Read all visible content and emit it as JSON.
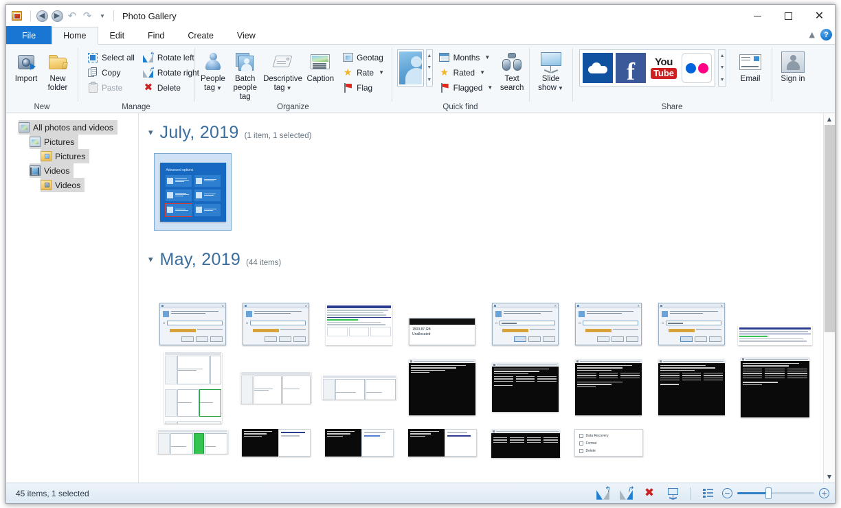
{
  "window": {
    "title": "Photo Gallery",
    "app_icon": "photo-gallery-icon",
    "quick_access": [
      {
        "name": "back-button",
        "icon": "back-arrow-icon"
      },
      {
        "name": "forward-button",
        "icon": "forward-arrow-icon"
      },
      {
        "name": "undo-button",
        "icon": "undo-icon"
      },
      {
        "name": "redo-button",
        "icon": "redo-icon"
      },
      {
        "name": "customize-qat-button",
        "icon": "chevron-down-icon"
      }
    ],
    "controls": {
      "minimize": "minimize-icon",
      "maximize": "maximize-icon",
      "close": "close-icon"
    }
  },
  "tabs": [
    {
      "label": "File",
      "state": "file"
    },
    {
      "label": "Home",
      "state": "active"
    },
    {
      "label": "Edit",
      "state": "normal"
    },
    {
      "label": "Find",
      "state": "normal"
    },
    {
      "label": "Create",
      "state": "normal"
    },
    {
      "label": "View",
      "state": "normal"
    }
  ],
  "tabstrip_right": {
    "collapse_ribbon": "chevron-up-icon",
    "help": "?"
  },
  "ribbon": {
    "groups": [
      {
        "name": "New",
        "label": "New",
        "big_buttons": [
          {
            "label": "Import",
            "icon": "camera-import-icon"
          },
          {
            "label": "New folder",
            "icon": "new-folder-icon"
          }
        ]
      },
      {
        "name": "Manage",
        "label": "Manage",
        "small_columns": [
          [
            {
              "label": "Select all",
              "icon": "select-all-icon",
              "disabled": false
            },
            {
              "label": "Copy",
              "icon": "copy-icon",
              "disabled": false
            },
            {
              "label": "Paste",
              "icon": "paste-icon",
              "disabled": true
            }
          ],
          [
            {
              "label": "Rotate left",
              "icon": "rotate-left-icon",
              "disabled": false
            },
            {
              "label": "Rotate right",
              "icon": "rotate-right-icon",
              "disabled": false
            },
            {
              "label": "Delete",
              "icon": "delete-icon",
              "disabled": false
            }
          ]
        ]
      },
      {
        "name": "Organize",
        "label": "Organize",
        "big_buttons": [
          {
            "label": "People tag",
            "icon": "person-icon",
            "dropdown": true
          },
          {
            "label": "Batch people tag",
            "icon": "batch-people-icon",
            "dropdown": false
          },
          {
            "label": "Descriptive tag",
            "icon": "tag-icon",
            "dropdown": true
          },
          {
            "label": "Caption",
            "icon": "caption-icon",
            "dropdown": false
          }
        ],
        "small_columns": [
          [
            {
              "label": "Geotag",
              "icon": "geotag-icon",
              "dropdown": false
            },
            {
              "label": "Rate",
              "icon": "star-icon",
              "dropdown": true
            },
            {
              "label": "Flag",
              "icon": "flag-icon",
              "dropdown": false
            }
          ]
        ]
      },
      {
        "name": "Quick find",
        "label": "Quick find",
        "gallery": {
          "name": "people-preview",
          "icon": "person-portrait-icon"
        },
        "small_columns": [
          [
            {
              "label": "Months",
              "icon": "calendar-icon",
              "dropdown": true
            },
            {
              "label": "Rated",
              "icon": "star-icon",
              "dropdown": true
            },
            {
              "label": "Flagged",
              "icon": "flag-icon",
              "dropdown": true
            }
          ]
        ],
        "big_buttons": [
          {
            "label": "Text search",
            "icon": "binoculars-icon",
            "dropdown": false
          }
        ]
      },
      {
        "name": "Slideshow",
        "label": "",
        "big_buttons": [
          {
            "label": "Slide show",
            "icon": "projector-icon",
            "dropdown": true
          }
        ]
      },
      {
        "name": "Share",
        "label": "Share",
        "tiles": [
          {
            "name": "onedrive-tile",
            "label": "OneDrive"
          },
          {
            "name": "facebook-tile",
            "label": "f"
          },
          {
            "name": "youtube-tile",
            "label_top": "You",
            "label_bottom": "Tube"
          },
          {
            "name": "flickr-tile",
            "label": "Flickr"
          }
        ],
        "big_buttons": [
          {
            "label": "Email",
            "icon": "email-icon",
            "dropdown": false
          }
        ]
      },
      {
        "name": "SignIn",
        "label": "",
        "big_buttons": [
          {
            "label": "Sign in",
            "icon": "signin-person-icon",
            "dropdown": false
          }
        ]
      }
    ]
  },
  "sidebar": {
    "items": [
      {
        "label": "All photos and videos",
        "icon": "all-media-icon",
        "indent": 0,
        "selected": true
      },
      {
        "label": "Pictures",
        "icon": "pictures-library-icon",
        "indent": 1,
        "selected": true
      },
      {
        "label": "Pictures",
        "icon": "pictures-folder-icon",
        "indent": 2,
        "selected": true
      },
      {
        "label": "Videos",
        "icon": "videos-library-icon",
        "indent": 1,
        "selected": true
      },
      {
        "label": "Videos",
        "icon": "videos-folder-icon",
        "indent": 2,
        "selected": true
      }
    ]
  },
  "gallery": {
    "groups": [
      {
        "title": "July, 2019",
        "count": "(1 item, 1 selected)",
        "chevron": "chevron-down-icon",
        "thumbnails": [
          {
            "name": "thumbnail-advanced-options",
            "kind": "winblue",
            "caption": "Advanced options",
            "selected": true,
            "tiles": [
              "Startup Repair",
              "Command Prompt",
              "System Image Recovery",
              "Startup Settings",
              "Startup Repair",
              "UEFI Firmware Settings"
            ]
          }
        ]
      },
      {
        "title": "May, 2019",
        "count": "(44 items)",
        "chevron": "chevron-down-icon",
        "rows": [
          [
            {
              "name": "thumbnail-run-dialog-1",
              "kind": "dialog",
              "filled": false
            },
            {
              "name": "thumbnail-run-dialog-2",
              "kind": "dialog",
              "filled": false
            },
            {
              "name": "thumbnail-disk-table-1",
              "kind": "report"
            },
            {
              "name": "thumbnail-unallocated",
              "kind": "unalloc",
              "line1": "1503.87 GB",
              "line2": "Unallocated"
            },
            {
              "name": "thumbnail-run-dialog-3",
              "kind": "dialog",
              "filled": true
            },
            {
              "name": "thumbnail-run-dialog-4",
              "kind": "dialog",
              "filled": false
            },
            {
              "name": "thumbnail-run-dialog-5",
              "kind": "dialog",
              "filled": true
            },
            {
              "name": "thumbnail-disk-table-2",
              "kind": "report-wide"
            }
          ],
          [
            {
              "name": "thumbnail-disk-management-menu",
              "kind": "diskmenu"
            },
            {
              "name": "thumbnail-disk-management-1",
              "kind": "diskmgr"
            },
            {
              "name": "thumbnail-disk-management-2",
              "kind": "diskmgr-wide"
            },
            {
              "name": "thumbnail-cmd-1",
              "kind": "terminal"
            },
            {
              "name": "thumbnail-cmd-2",
              "kind": "terminal"
            },
            {
              "name": "thumbnail-cmd-3",
              "kind": "terminal"
            },
            {
              "name": "thumbnail-cmd-4",
              "kind": "terminal"
            },
            {
              "name": "thumbnail-cmd-5",
              "kind": "terminal"
            }
          ],
          [
            {
              "name": "thumbnail-disk-management-3",
              "kind": "diskmgr-wide"
            },
            {
              "name": "thumbnail-cmd-6",
              "kind": "terminal-split"
            },
            {
              "name": "thumbnail-cmd-7",
              "kind": "terminal-split"
            },
            {
              "name": "thumbnail-cmd-8",
              "kind": "terminal-split"
            },
            {
              "name": "thumbnail-cmd-9",
              "kind": "terminal-split"
            },
            {
              "name": "thumbnail-context-menu",
              "kind": "menu",
              "items": [
                "Data Recovery",
                "Format",
                "Delete"
              ]
            }
          ]
        ]
      }
    ]
  },
  "scrollbar": {
    "up_arrow": "chevron-up-icon",
    "down_arrow": "chevron-down-icon",
    "thumb_top_pct": 0,
    "thumb_height_pct": 60
  },
  "status_bar": {
    "text": "45 items, 1 selected",
    "buttons": [
      {
        "name": "rotate-left-button",
        "icon": "rotate-left-icon"
      },
      {
        "name": "rotate-right-button",
        "icon": "rotate-right-icon"
      },
      {
        "name": "delete-button",
        "icon": "delete-icon"
      },
      {
        "name": "play-slideshow-button",
        "icon": "projector-icon"
      }
    ],
    "view_toggle": {
      "name": "details-view-button",
      "icon": "list-view-icon"
    },
    "zoom": {
      "out_label": "−",
      "in_label": "+",
      "value_pct": 38
    }
  },
  "colors": {
    "accent": "#1976d2",
    "group_title": "#3a6e9e",
    "ribbon_bg": "#f4f8fb",
    "status_bg": "#e5eff8",
    "selection": "#cfe2f5"
  }
}
